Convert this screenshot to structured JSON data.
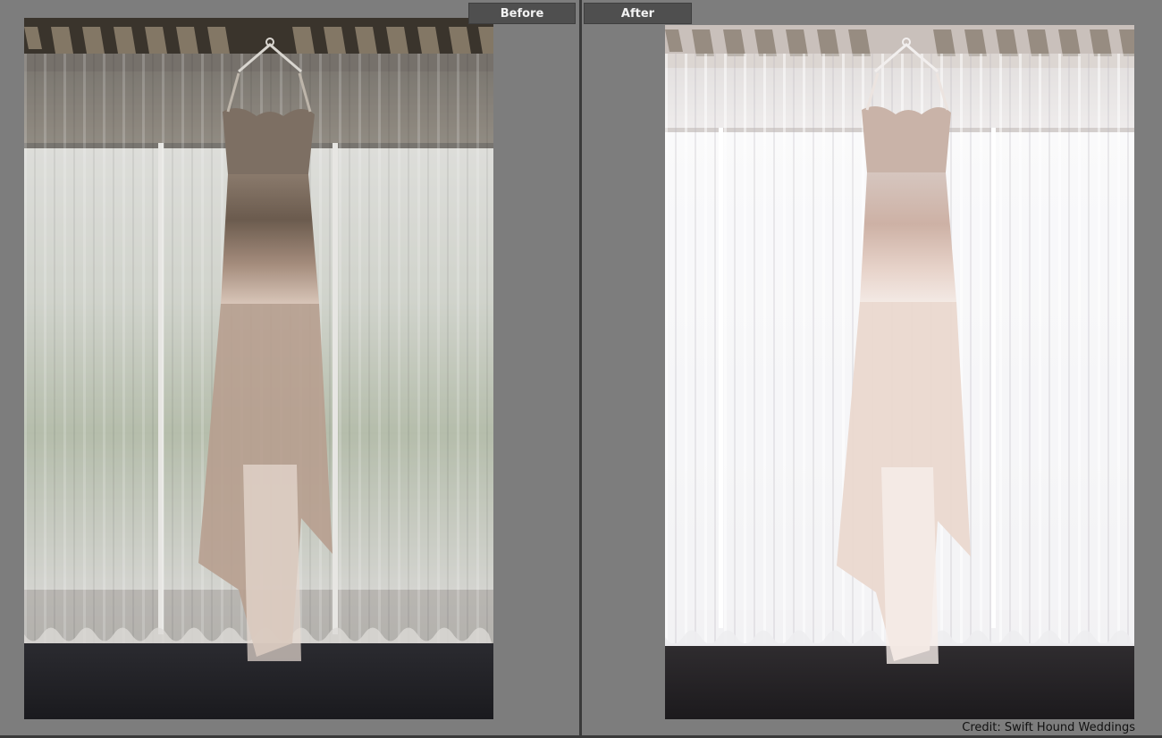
{
  "labels": {
    "before": "Before",
    "after": "After"
  },
  "credit": "Credit: Swift Hound Weddings",
  "colors": {
    "background": "#7d7d7d",
    "label_bg": "#4f4f4f",
    "label_text": "#f2f2f2",
    "divider": "#3a3a3a"
  },
  "panes": [
    {
      "name": "before",
      "image_desc_icon": "wedding-dress-photo-icon"
    },
    {
      "name": "after",
      "image_desc_icon": "wedding-dress-photo-icon"
    }
  ]
}
